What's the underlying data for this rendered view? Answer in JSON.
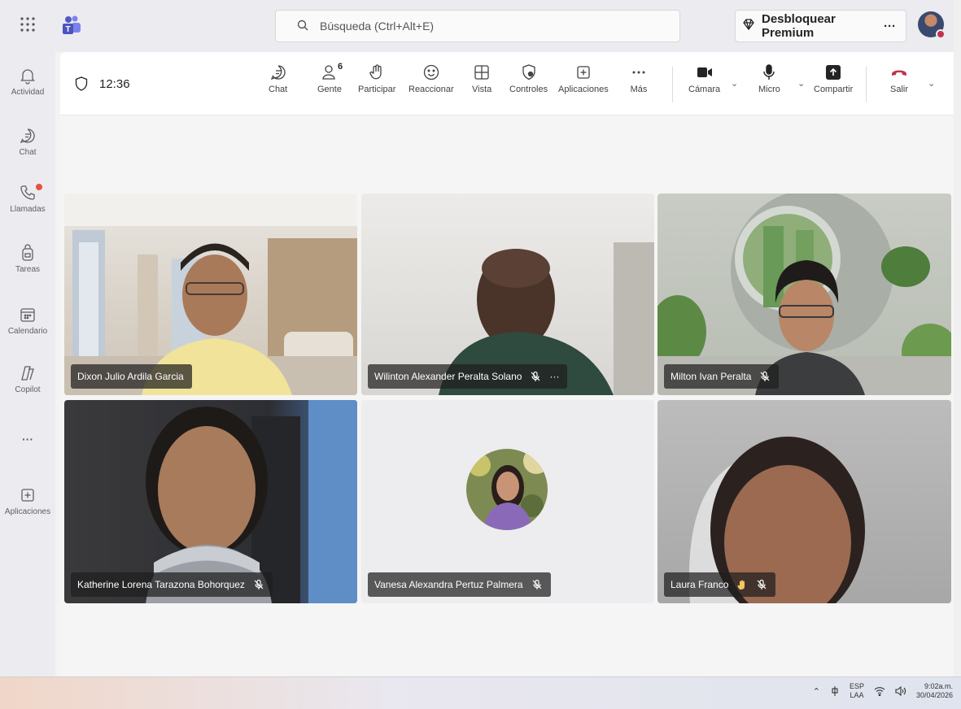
{
  "topbar": {
    "search_placeholder": "Búsqueda (Ctrl+Alt+E)",
    "premium_label": "Desbloquear Premium",
    "more_label": "···"
  },
  "rail": {
    "items": [
      {
        "label": "Actividad",
        "icon": "bell-icon"
      },
      {
        "label": "Chat",
        "icon": "chat-icon"
      },
      {
        "label": "Llamadas",
        "icon": "phone-icon"
      },
      {
        "label": "Tareas",
        "icon": "backpack-icon"
      },
      {
        "label": "Calendario",
        "icon": "calendar-icon"
      },
      {
        "label": "Copilot",
        "icon": "copilot-icon"
      },
      {
        "label": "Aplicaciones",
        "icon": "add-app-icon"
      }
    ],
    "more": "···"
  },
  "toolbar": {
    "timer": "12:36",
    "people_count": "6",
    "buttons": [
      {
        "label": "Chat"
      },
      {
        "label": "Gente"
      },
      {
        "label": "Participar"
      },
      {
        "label": "Reaccionar"
      },
      {
        "label": "Vista"
      },
      {
        "label": "Controles"
      },
      {
        "label": "Aplicaciones"
      },
      {
        "label": "Más"
      },
      {
        "label": "Cámara"
      },
      {
        "label": "Micro"
      },
      {
        "label": "Compartir"
      },
      {
        "label": "Salir"
      }
    ]
  },
  "participants": [
    {
      "name": "Dixon Julio Ardila Garcia",
      "muted": false
    },
    {
      "name": "Wilinton Alexander Peralta Solano",
      "muted": true,
      "more": "···"
    },
    {
      "name": "Milton Ivan Peralta",
      "muted": true
    },
    {
      "name": "Katherine Lorena Tarazona Bohorquez",
      "muted": true
    },
    {
      "name": "Vanesa Alexandra Pertuz Palmera",
      "muted": true
    },
    {
      "name": "Laura Franco",
      "muted": true
    }
  ],
  "taskbar": {
    "lang_top": "ESP",
    "lang_bottom": "LAA",
    "time": "9:02a.m.",
    "date": "30/04/2026"
  },
  "colors": {
    "leave": "#c4314b",
    "notification": "#e5533d"
  }
}
